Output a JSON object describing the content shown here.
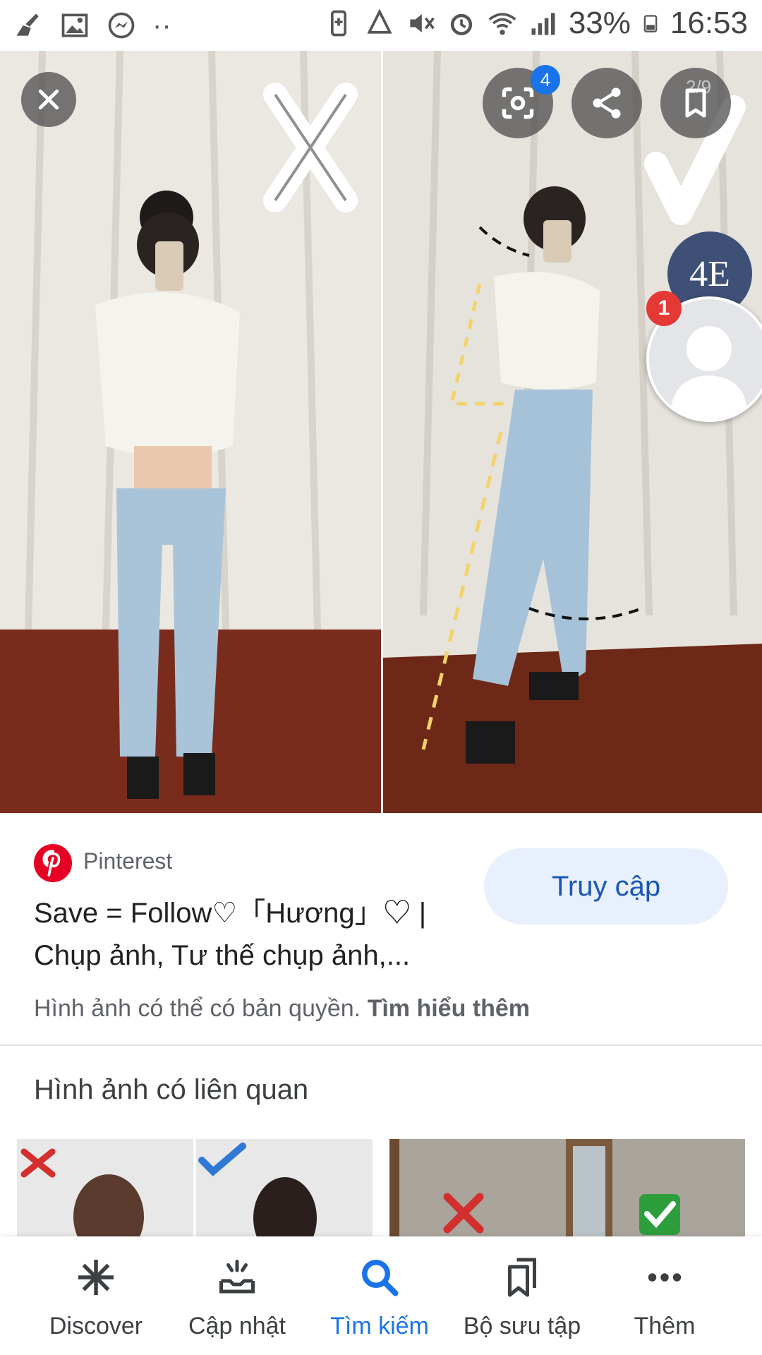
{
  "status_bar": {
    "battery": "33%",
    "time": "16:53"
  },
  "viewer": {
    "counter": "2/9",
    "lens_badge": "4",
    "chat_bubble_text": "4E",
    "avatar_badge": "1",
    "image_marks": {
      "left": "X",
      "right": "✓"
    }
  },
  "result": {
    "source": "Pinterest",
    "visit_label": "Truy cập",
    "title": "Save = Follow♡「Hương」♡ | Chụp ảnh, Tư thế chụp ảnh,...",
    "copyright_text": "Hình ảnh có thể có bản quyền.",
    "learn_more": "Tìm hiểu thêm"
  },
  "related": {
    "heading": "Hình ảnh có liên quan"
  },
  "bottom_nav": {
    "items": [
      {
        "label": "Discover",
        "icon": "asterisk-icon"
      },
      {
        "label": "Cập nhật",
        "icon": "updates-tray-icon"
      },
      {
        "label": "Tìm kiếm",
        "icon": "search-icon",
        "active": true
      },
      {
        "label": "Bộ sưu tập",
        "icon": "collections-icon"
      },
      {
        "label": "Thêm",
        "icon": "more-dots-icon"
      }
    ]
  },
  "colors": {
    "accent": "#1a73e8",
    "pinterest_red": "#e60023",
    "visit_button_bg": "#e8f0fe"
  }
}
